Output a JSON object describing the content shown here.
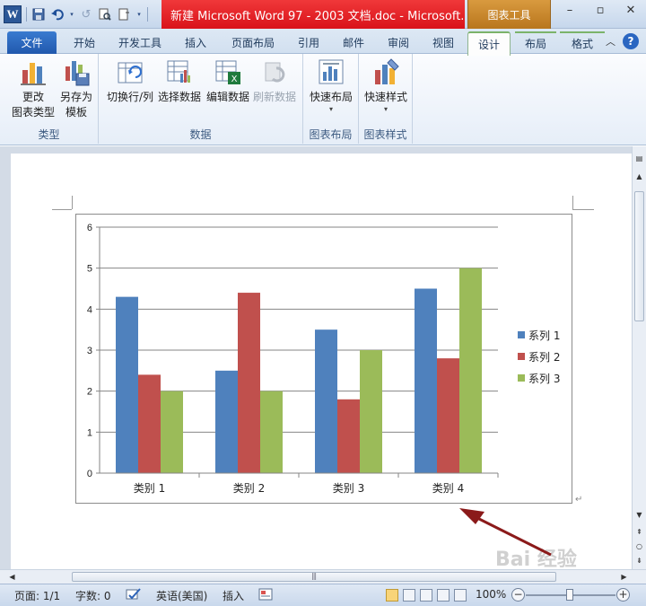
{
  "titlebar": {
    "title": "新建 Microsoft Word 97 - 2003 文档.doc - Microsoft...",
    "context_tools": "图表工具",
    "word_logo": "W"
  },
  "tabs": {
    "file": "文件",
    "home": "开始",
    "developer": "开发工具",
    "insert": "插入",
    "page_layout": "页面布局",
    "references": "引用",
    "mailings": "邮件",
    "review": "审阅",
    "view": "视图",
    "design": "设计",
    "layout": "布局",
    "format": "格式"
  },
  "ribbon": {
    "type_group": {
      "label": "类型",
      "change_type_line1": "更改",
      "change_type_line2": "图表类型",
      "save_template_line1": "另存为",
      "save_template_line2": "模板"
    },
    "data_group": {
      "label": "数据",
      "switch_row_col": "切换行/列",
      "select_data": "选择数据",
      "edit_data": "编辑数据",
      "refresh_data": "刷新数据"
    },
    "layouts_group": {
      "label": "图表布局",
      "quick_layout": "快速布局"
    },
    "styles_group": {
      "label": "图表样式",
      "quick_styles": "快速样式"
    }
  },
  "chart_data": {
    "type": "bar",
    "categories": [
      "类别 1",
      "类别 2",
      "类别 3",
      "类别 4"
    ],
    "series": [
      {
        "name": "系列 1",
        "values": [
          4.3,
          2.5,
          3.5,
          4.5
        ],
        "color": "#4f81bd"
      },
      {
        "name": "系列 2",
        "values": [
          2.4,
          4.4,
          1.8,
          2.8
        ],
        "color": "#c0504d"
      },
      {
        "name": "系列 3",
        "values": [
          2,
          2,
          3,
          5
        ],
        "color": "#9bbb59"
      }
    ],
    "ylim": [
      0,
      6
    ],
    "yticks": [
      "0",
      "1",
      "2",
      "3",
      "4",
      "5",
      "6"
    ],
    "grid": true,
    "legend": "right"
  },
  "status": {
    "page": "页面: 1/1",
    "words": "字数: 0",
    "language": "英语(美国)",
    "insert_mode": "插入",
    "zoom": "100%"
  },
  "watermark": "Bai 经验"
}
